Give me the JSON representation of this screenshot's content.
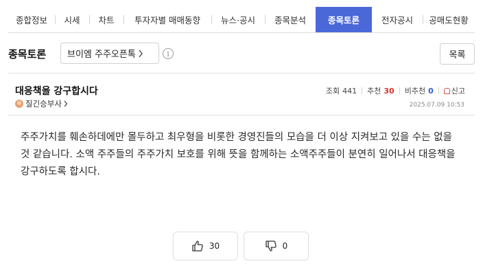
{
  "tabs": [
    {
      "label": "종합정보",
      "active": false
    },
    {
      "label": "시세",
      "active": false
    },
    {
      "label": "차트",
      "active": false
    },
    {
      "label": "투자자별 매매동향",
      "active": false
    },
    {
      "label": "뉴스·공시",
      "active": false
    },
    {
      "label": "종목분석",
      "active": false
    },
    {
      "label": "종목토론",
      "active": true
    },
    {
      "label": "전자공시",
      "active": false
    },
    {
      "label": "공매도현황",
      "active": false
    }
  ],
  "header": {
    "board_title": "종목토론",
    "stock_select": "브이엠 주주오픈톡",
    "info_icon": "ⓘ",
    "list_button": "목록"
  },
  "post": {
    "title": "대응책을 강구합시다",
    "author": "질긴승부사",
    "views_label": "조회",
    "views": "441",
    "recommend_label": "추천",
    "recommend": "30",
    "not_recommend_label": "비추천",
    "not_recommend": "0",
    "report_label": "신고",
    "date": "2025.07.09 10:53",
    "body": "주주가치를 훼손하데에만 몰두하고 최우형을 비롯한 경영진들의 모습을 더 이상 지켜보고 있을 수는 없을 것 같습니다. 소액 주주들의 주주가치 보호를 위해 뜻을 함께하는 소액주주들이 분연히 일어나서 대응책을 강구하도록 합시다."
  },
  "votes": {
    "like_count": "30",
    "dislike_count": "0"
  },
  "colors": {
    "active_tab": "#4b68d8",
    "recommend": "#d6332b",
    "not_recommend": "#2a5bd7"
  }
}
